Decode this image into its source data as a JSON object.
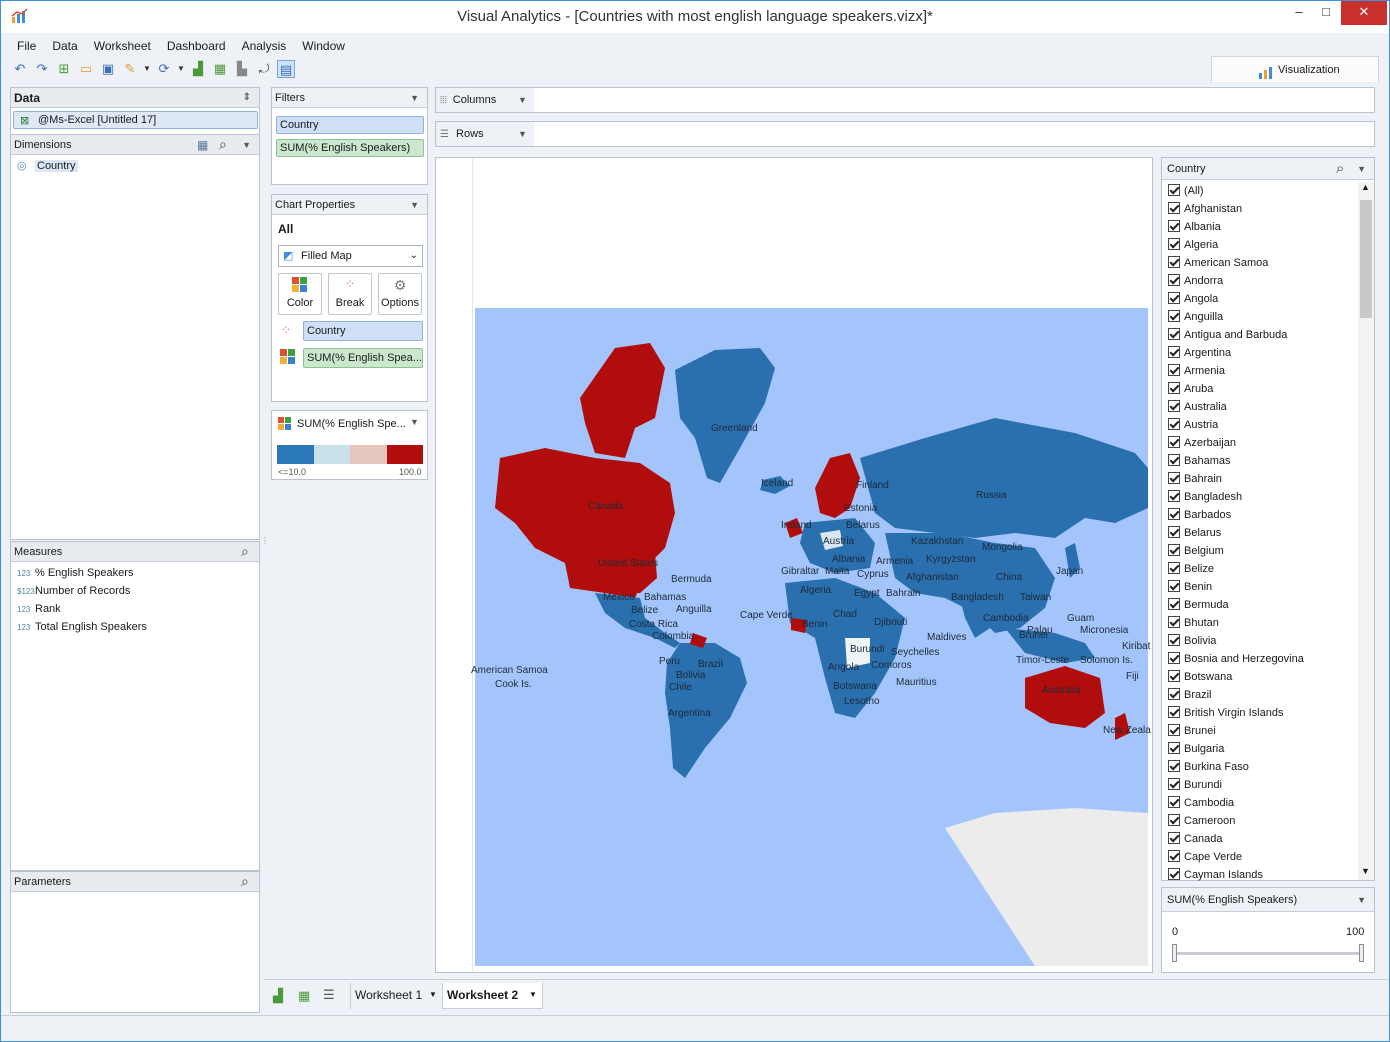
{
  "window": {
    "title": "Visual Analytics - [Countries with most english language speakers.vizx]*",
    "minimize": "–",
    "maximize": "□",
    "close": "✕"
  },
  "menu": [
    "File",
    "Data",
    "Worksheet",
    "Dashboard",
    "Analysis",
    "Window"
  ],
  "toolbar_icons": [
    "undo-icon",
    "redo-icon",
    "new-icon",
    "open-icon",
    "save-icon",
    "brush-icon",
    "refresh-icon",
    "add-chart-icon",
    "add-table-icon",
    "chart-icon",
    "swap-icon",
    "presentation-icon"
  ],
  "viz_tab": {
    "label": "Visualization"
  },
  "data_panel": {
    "title": "Data",
    "source": "@Ms-Excel [Untitled 17]",
    "dimensions_title": "Dimensions",
    "dimensions": [
      "Country"
    ],
    "measures_title": "Measures",
    "measures": [
      {
        "badge": "123",
        "label": "% English Speakers"
      },
      {
        "badge": "$123",
        "label": "Number of Records"
      },
      {
        "badge": "123",
        "label": "Rank"
      },
      {
        "badge": "123",
        "label": "Total English Speakers"
      }
    ],
    "parameters_title": "Parameters"
  },
  "filters": {
    "title": "Filters",
    "items": [
      "Country",
      "SUM(% English Speakers)"
    ]
  },
  "chart_props": {
    "title": "Chart Properties",
    "scope": "All",
    "chart_type": "Filled Map",
    "buttons": [
      "Color",
      "Break",
      "Options"
    ],
    "break_field": "Country",
    "color_field": "SUM(% English Spea..."
  },
  "legend": {
    "title": "SUM(% English Spe...",
    "min_label": "<=10.0",
    "max_label": "100.0",
    "colors": [
      "#2a78b8",
      "#c9e2ea",
      "#e6c7c0",
      "#b20d0d"
    ]
  },
  "shelves": {
    "columns": "Columns",
    "rows": "Rows"
  },
  "map_labels": [
    "Greenland",
    "Canada",
    "United States",
    "Iceland",
    "Finland",
    "Estonia",
    "Russia",
    "Ireland",
    "Belarus",
    "Austria",
    "Kazakhstan",
    "Mongolia",
    "Gibraltar",
    "Malta",
    "Albania",
    "Armenia",
    "Kyrgyzstan",
    "Cyprus",
    "Afghanistan",
    "China",
    "Japan",
    "Mexico",
    "Bermuda",
    "Bahamas",
    "Algeria",
    "Egypt",
    "Bahrain",
    "Bangladesh",
    "Taiwan",
    "Belize",
    "Anguilla",
    "Cape Verde",
    "Chad",
    "Costa Rica",
    "Benin",
    "Djibouti",
    "Cambodia",
    "Guam",
    "Colombia",
    "Palau",
    "Micronesia",
    "Brunei",
    "Maldives",
    "Burundi",
    "Seychelles",
    "Kiribat",
    "American Samoa",
    "Peru",
    "Brazil",
    "Timor-Leste",
    "Solomon Is.",
    "Angola",
    "Comoros",
    "Cook Is.",
    "Bolivia",
    "Fiji",
    "Chile",
    "Mauritius",
    "Botswana",
    "Australia",
    "Lesotho",
    "Argentina",
    "New Zeala"
  ],
  "country_filter": {
    "title": "Country",
    "items": [
      "(All)",
      "Afghanistan",
      "Albania",
      "Algeria",
      "American Samoa",
      "Andorra",
      "Angola",
      "Anguilla",
      "Antigua and Barbuda",
      "Argentina",
      "Armenia",
      "Aruba",
      "Australia",
      "Austria",
      "Azerbaijan",
      "Bahamas",
      "Bahrain",
      "Bangladesh",
      "Barbados",
      "Belarus",
      "Belgium",
      "Belize",
      "Benin",
      "Bermuda",
      "Bhutan",
      "Bolivia",
      "Bosnia and Herzegovina",
      "Botswana",
      "Brazil",
      "British Virgin Islands",
      "Brunei",
      "Bulgaria",
      "Burkina Faso",
      "Burundi",
      "Cambodia",
      "Cameroon",
      "Canada",
      "Cape Verde",
      "Cayman Islands"
    ]
  },
  "range_filter": {
    "title": "SUM(% English Speakers)",
    "min": "0",
    "max": "100"
  },
  "sheets": [
    "Worksheet 1",
    "Worksheet 2"
  ]
}
